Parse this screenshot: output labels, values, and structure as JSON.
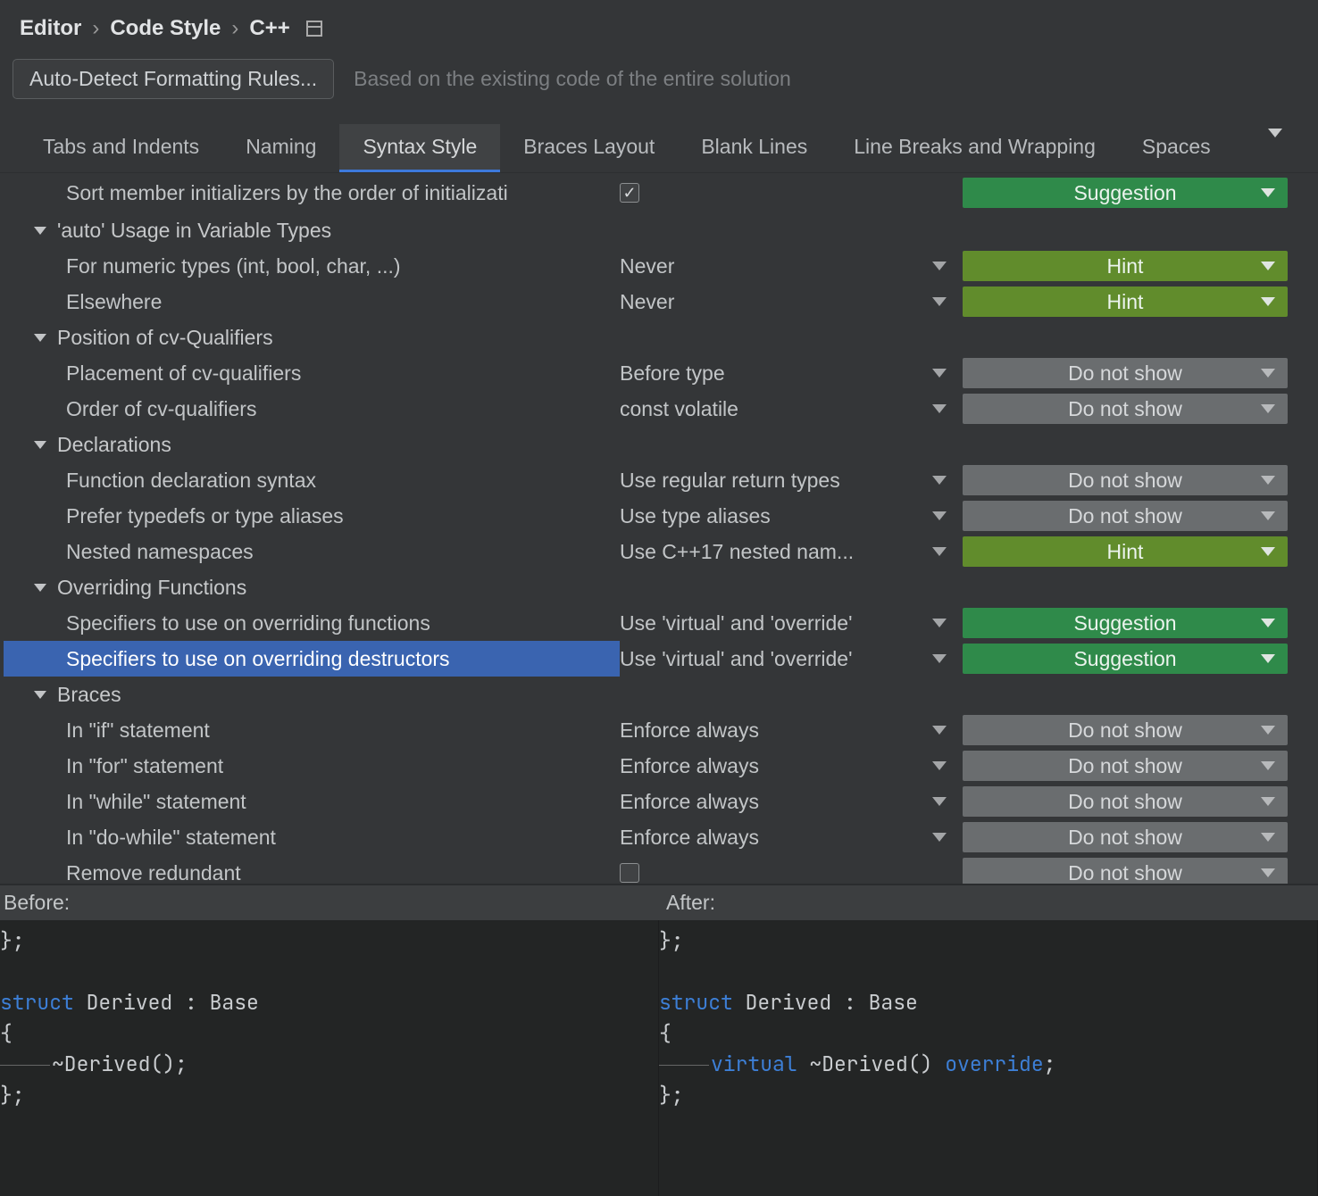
{
  "breadcrumb": [
    "Editor",
    "Code Style",
    "C++"
  ],
  "autoDetect": {
    "label": "Auto-Detect Formatting Rules...",
    "hint": "Based on the existing code of the entire solution"
  },
  "tabs": [
    "Tabs and Indents",
    "Naming",
    "Syntax Style",
    "Braces Layout",
    "Blank Lines",
    "Line Breaks and Wrapping",
    "Spaces"
  ],
  "activeTab": 2,
  "rows": [
    {
      "type": "item",
      "first": true,
      "label": "Sort member initializers by the order of initializati",
      "value": {
        "kind": "check",
        "checked": true
      },
      "severity": "Suggestion"
    },
    {
      "type": "group",
      "label": "'auto' Usage in Variable Types"
    },
    {
      "type": "item",
      "label": "For numeric types (int, bool, char, ...)",
      "value": {
        "kind": "dd",
        "text": "Never"
      },
      "severity": "Hint"
    },
    {
      "type": "item",
      "label": "Elsewhere",
      "value": {
        "kind": "dd",
        "text": "Never"
      },
      "severity": "Hint"
    },
    {
      "type": "group",
      "label": "Position of cv-Qualifiers"
    },
    {
      "type": "item",
      "label": "Placement of cv-qualifiers",
      "value": {
        "kind": "dd",
        "text": "Before type"
      },
      "severity": "Do not show"
    },
    {
      "type": "item",
      "label": "Order of cv-qualifiers",
      "value": {
        "kind": "dd",
        "text": "const volatile"
      },
      "severity": "Do not show"
    },
    {
      "type": "group",
      "label": "Declarations"
    },
    {
      "type": "item",
      "label": "Function declaration syntax",
      "value": {
        "kind": "dd",
        "text": "Use regular return types"
      },
      "severity": "Do not show"
    },
    {
      "type": "item",
      "label": "Prefer typedefs or type aliases",
      "value": {
        "kind": "dd",
        "text": "Use type aliases"
      },
      "severity": "Do not show"
    },
    {
      "type": "item",
      "label": "Nested namespaces",
      "value": {
        "kind": "dd",
        "text": "Use C++17 nested nam..."
      },
      "severity": "Hint"
    },
    {
      "type": "group",
      "label": "Overriding Functions"
    },
    {
      "type": "item",
      "label": "Specifiers to use on overriding functions",
      "value": {
        "kind": "dd",
        "text": "Use 'virtual' and 'override'"
      },
      "severity": "Suggestion"
    },
    {
      "type": "item",
      "selected": true,
      "label": "Specifiers to use on overriding destructors",
      "value": {
        "kind": "dd",
        "text": "Use 'virtual' and 'override'"
      },
      "severity": "Suggestion"
    },
    {
      "type": "group",
      "label": "Braces"
    },
    {
      "type": "item",
      "label": "In \"if\" statement",
      "value": {
        "kind": "dd",
        "text": "Enforce always"
      },
      "severity": "Do not show"
    },
    {
      "type": "item",
      "label": "In \"for\" statement",
      "value": {
        "kind": "dd",
        "text": "Enforce always"
      },
      "severity": "Do not show"
    },
    {
      "type": "item",
      "label": "In \"while\" statement",
      "value": {
        "kind": "dd",
        "text": "Enforce always"
      },
      "severity": "Do not show"
    },
    {
      "type": "item",
      "label": "In \"do-while\" statement",
      "value": {
        "kind": "dd",
        "text": "Enforce always"
      },
      "severity": "Do not show"
    },
    {
      "type": "item",
      "label": "Remove redundant",
      "value": {
        "kind": "check",
        "checked": false
      },
      "severity": "Do not show"
    }
  ],
  "preview": {
    "beforeLabel": "Before:",
    "afterLabel": "After:",
    "before": {
      "l0": "};",
      "l2a": "struct",
      "l2b": " Derived : Base",
      "l3": "{",
      "l4": "~Derived();",
      "l5": "};"
    },
    "after": {
      "l0": "};",
      "l2a": "struct",
      "l2b": " Derived : Base",
      "l3": "{",
      "l4a": "virtual",
      "l4b": " ~Derived() ",
      "l4c": "override",
      "l4d": ";",
      "l5": "};"
    }
  }
}
